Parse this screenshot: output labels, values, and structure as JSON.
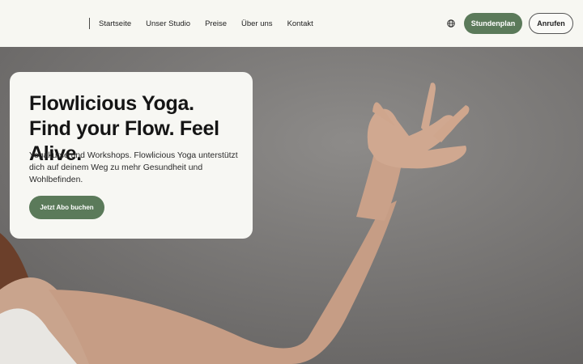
{
  "header": {
    "nav": [
      "Startseite",
      "Unser Studio",
      "Preise",
      "Über uns",
      "Kontakt"
    ],
    "cta_primary": "Stundenplan",
    "cta_secondary": "Anrufen",
    "language_icon": "globe-icon"
  },
  "hero": {
    "title": "Flowlicious Yoga. Find your Flow. Feel Alive.",
    "description": "Yogakurse und Workshops. Flowlicious Yoga unterstützt dich auf deinem Weg zu mehr Gesundheit und Wohlbefinden.",
    "cta": "Jetzt Abo buchen"
  },
  "colors": {
    "accent_green": "#5b7a5a",
    "background": "#f7f7f2",
    "text": "#151515"
  }
}
